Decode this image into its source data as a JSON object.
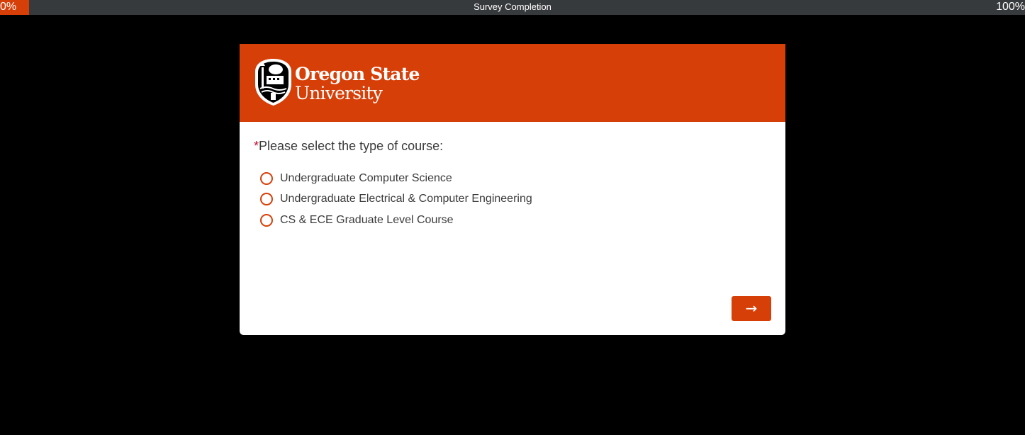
{
  "progress": {
    "title": "Survey Completion",
    "start_label": "0%",
    "end_label": "100%",
    "value_percent": 0
  },
  "header": {
    "logo_line1": "Oregon State",
    "logo_line2": "University",
    "logo_icon": "osu-seal-icon"
  },
  "question": {
    "required_mark": "*",
    "text": "Please select the type of course:",
    "options": [
      {
        "label": "Undergraduate Computer Science",
        "selected": false
      },
      {
        "label": "Undergraduate Electrical & Computer Engineering",
        "selected": false
      },
      {
        "label": "CS & ECE Graduate Level Course",
        "selected": false
      }
    ]
  },
  "navigation": {
    "next_label": "→"
  },
  "colors": {
    "accent": "#d73f09",
    "progress_track": "#373a3d",
    "background": "#000000",
    "required": "#c8102e"
  }
}
